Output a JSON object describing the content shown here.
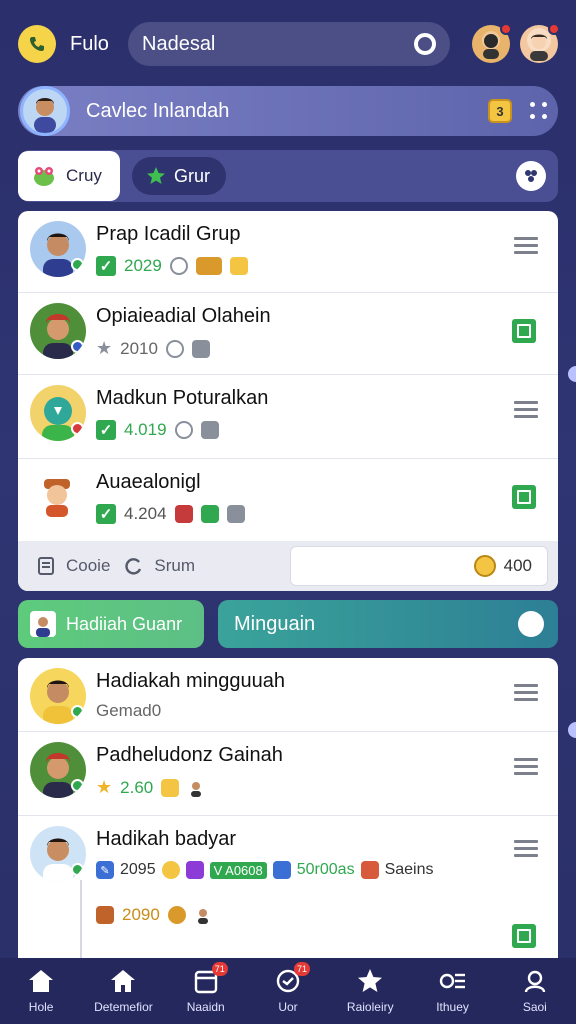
{
  "header": {
    "app_name": "Fulo",
    "search_value": "Nadesal"
  },
  "profile": {
    "name": "Cavlec Inlandah",
    "badge": "3"
  },
  "group_tabs": {
    "active_label": "Cruy",
    "inactive_label": "Grur"
  },
  "group_list": [
    {
      "title": "Prap Icadil Grup",
      "meta": "2029"
    },
    {
      "title": "Opiaieadial Olahein",
      "meta": "2010"
    },
    {
      "title": "Madkun Poturalkan",
      "meta": "4.019"
    },
    {
      "title": "Auaealonigl",
      "meta": "4.204"
    }
  ],
  "group_footer": {
    "link1": "Cooie",
    "link2": "Srum",
    "score": "400"
  },
  "weekly": {
    "left_label": "Hadiiah Guanr",
    "right_label": "Minguain"
  },
  "weekly_list": [
    {
      "title": "Hadiakah mingguuah",
      "sub": "Gemad0"
    },
    {
      "title": "Padheludonz Gainah",
      "meta": "2.60"
    },
    {
      "title": "Hadikah badyar",
      "meta": "2095",
      "tag": "V A0608",
      "meta2": "50r00as",
      "meta3": "Saeins",
      "meta4": "2090"
    }
  ],
  "bottom_nav": [
    {
      "label": "Hole",
      "badge": ""
    },
    {
      "label": "Detemefior",
      "badge": ""
    },
    {
      "label": "Naaidn",
      "badge": "71"
    },
    {
      "label": "Uor",
      "badge": "71"
    },
    {
      "label": "Raioleiry",
      "badge": ""
    },
    {
      "label": "Ithuey",
      "badge": ""
    },
    {
      "label": "Saoi",
      "badge": ""
    }
  ],
  "colors": {
    "background": "#2b2f6b",
    "accent_green": "#2fa84f",
    "accent_yellow": "#f4c542",
    "teal": "#2d7f95"
  }
}
